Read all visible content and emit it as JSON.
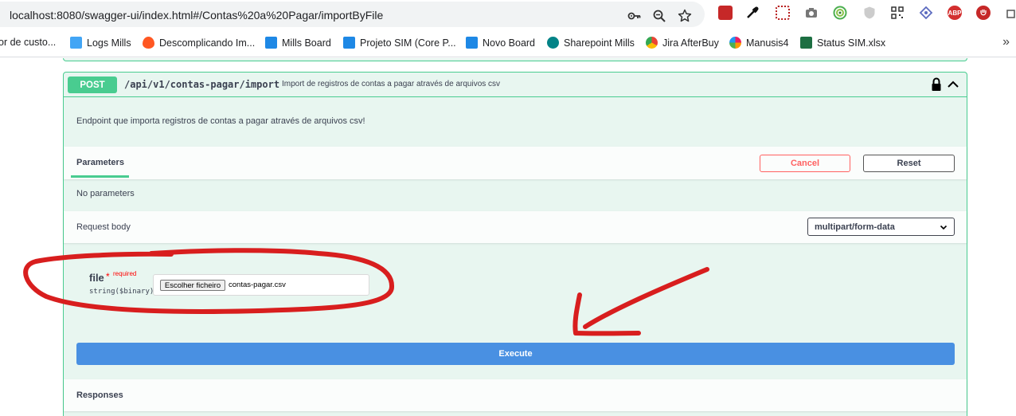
{
  "browser": {
    "url": "localhost:8080/swagger-ui/index.html#/Contas%20a%20Pagar/importByFile",
    "bookmarks": [
      {
        "label": "or de custo...",
        "icon": "none"
      },
      {
        "label": "Logs Mills",
        "icon": "puzzle-icon"
      },
      {
        "label": "Descomplicando Im...",
        "icon": "flame-icon"
      },
      {
        "label": "Mills Board",
        "icon": "azure-devops-icon"
      },
      {
        "label": "Projeto SIM (Core P...",
        "icon": "azure-devops-icon"
      },
      {
        "label": "Novo Board",
        "icon": "azure-devops-icon"
      },
      {
        "label": "Sharepoint Mills",
        "icon": "sharepoint-icon"
      },
      {
        "label": "Jira AfterBuy",
        "icon": "chrome-icon"
      },
      {
        "label": "Manusis4",
        "icon": "manusis-icon"
      },
      {
        "label": "Status SIM.xlsx",
        "icon": "excel-icon"
      }
    ],
    "more_label": "»",
    "extension_abp": "ABP"
  },
  "operation": {
    "method": "POST",
    "path": "/api/v1/contas-pagar/import",
    "summary": "Import de registros de contas a pagar através de arquivos csv",
    "description": "Endpoint que importa registros de contas a pagar através de arquivos csv!",
    "tabs": {
      "parameters": "Parameters"
    },
    "cancel_label": "Cancel",
    "reset_label": "Reset",
    "no_parameters": "No parameters",
    "request_body_label": "Request body",
    "content_type": "multipart/form-data",
    "file_field": {
      "name": "file",
      "required_star": "*",
      "required_label": "required",
      "type": "string($binary)",
      "choose_label": "Escolher ficheiro",
      "chosen_file": "contas-pagar.csv"
    },
    "execute_label": "Execute",
    "responses_label": "Responses"
  },
  "colors": {
    "post_green": "#49cc90",
    "execute_blue": "#4990e2",
    "cancel_red": "#ff6060",
    "annotation_red": "#d81e1e"
  }
}
